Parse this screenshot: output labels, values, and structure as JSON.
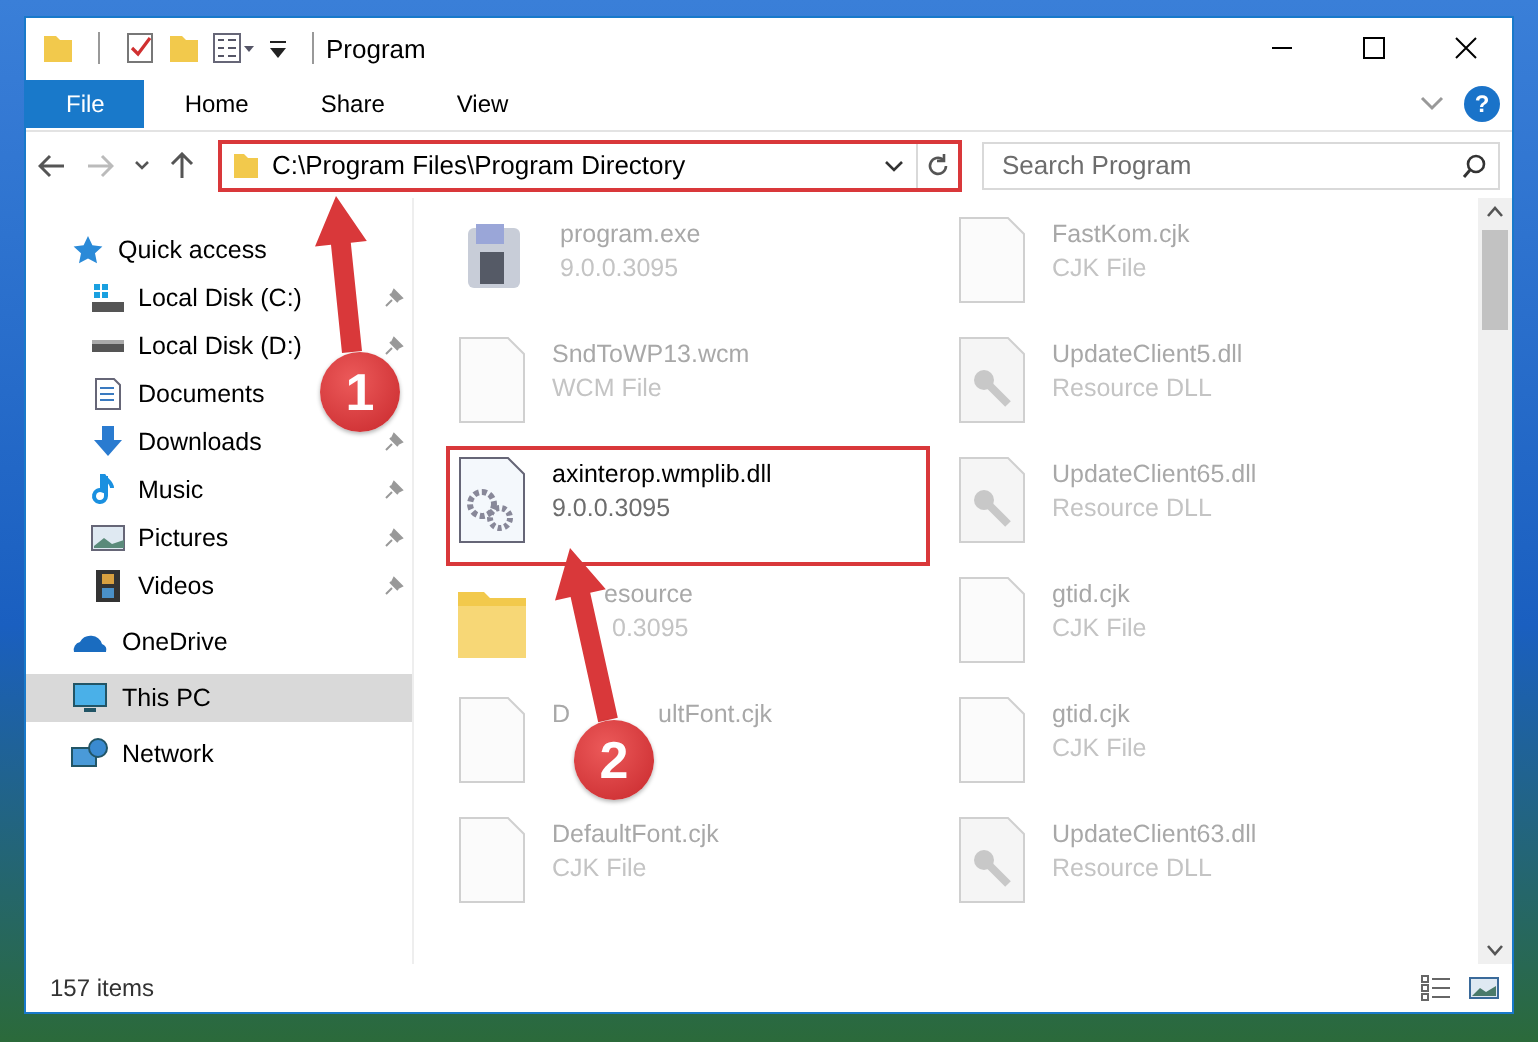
{
  "window": {
    "title": "Program"
  },
  "ribbon": {
    "tabs": [
      {
        "label": "File",
        "kind": "file",
        "selected": false
      },
      {
        "label": "Home",
        "kind": "tab",
        "selected": false
      },
      {
        "label": "Share",
        "kind": "tab",
        "selected": false
      },
      {
        "label": "View",
        "kind": "tab",
        "selected": false
      }
    ],
    "help": "?"
  },
  "address_bar": {
    "path": "C:\\Program Files\\Program Directory",
    "highlighted": true
  },
  "search": {
    "placeholder": "Search Program"
  },
  "sidebar": {
    "items": [
      {
        "label": "Quick access",
        "selected": false,
        "children": [
          {
            "label": "Local Disk (C:)",
            "pinned": true,
            "selected": false
          },
          {
            "label": "Local Disk (D:)",
            "pinned": true,
            "selected": false
          },
          {
            "label": "Documents",
            "selected": false
          },
          {
            "label": "Downloads",
            "pinned": true,
            "selected": false
          },
          {
            "label": "Music",
            "pinned": true,
            "selected": false
          },
          {
            "label": "Pictures",
            "pinned": true,
            "selected": false
          },
          {
            "label": "Videos",
            "pinned": true,
            "selected": false
          }
        ]
      },
      {
        "label": "OneDrive",
        "selected": false
      },
      {
        "label": "This PC",
        "selected": true
      },
      {
        "label": "Network",
        "selected": false
      }
    ]
  },
  "files": [
    {
      "name_parts": [
        "program.exe"
      ],
      "detail": "9.0.0.3095",
      "kind": "program",
      "highlighted": false,
      "dimmed": true
    },
    {
      "name_parts": [
        "SndToWP13.wcm"
      ],
      "detail": "WCM File",
      "kind": "blank",
      "highlighted": false,
      "dimmed": true
    },
    {
      "name_parts": [
        "axinterop.wmplib.dll"
      ],
      "detail": "9.0.0.3095",
      "kind": "gears",
      "highlighted": true,
      "dimmed": false
    },
    {
      "name_parts": [
        "esource"
      ],
      "detail": "0.3095",
      "kind": "folder",
      "highlighted": false,
      "dimmed": true
    },
    {
      "name_parts": [
        "D",
        "ultFont.cjk"
      ],
      "kind": "blank",
      "highlighted": false,
      "dimmed": true
    },
    {
      "name_parts": [
        "DefaultFont.cjk"
      ],
      "detail": "CJK File",
      "kind": "blank",
      "highlighted": false,
      "dimmed": true
    },
    {
      "name_parts": [
        "FastKom.cjk"
      ],
      "detail": "CJK File",
      "kind": "blank",
      "highlighted": false,
      "dimmed": true
    },
    {
      "name_parts": [
        "UpdateClient5.dll"
      ],
      "detail": "Resource DLL",
      "kind": "key",
      "highlighted": false,
      "dimmed": true
    },
    {
      "name_parts": [
        "UpdateClient65.dll"
      ],
      "detail": "Resource DLL",
      "kind": "key",
      "highlighted": false,
      "dimmed": true
    },
    {
      "name_parts": [
        "gtid.cjk"
      ],
      "detail": "CJK File",
      "kind": "blank",
      "highlighted": false,
      "dimmed": true
    },
    {
      "name_parts": [
        "gtid.cjk"
      ],
      "detail": "CJK File",
      "kind": "blank",
      "highlighted": false,
      "dimmed": true
    },
    {
      "name_parts": [
        "UpdateClient63.dll"
      ],
      "detail": "Resource DLL",
      "kind": "key",
      "highlighted": false,
      "dimmed": true
    }
  ],
  "status_bar": {
    "item_count": "157 items"
  },
  "annotations": [
    {
      "label": "1"
    },
    {
      "label": "2"
    }
  ]
}
